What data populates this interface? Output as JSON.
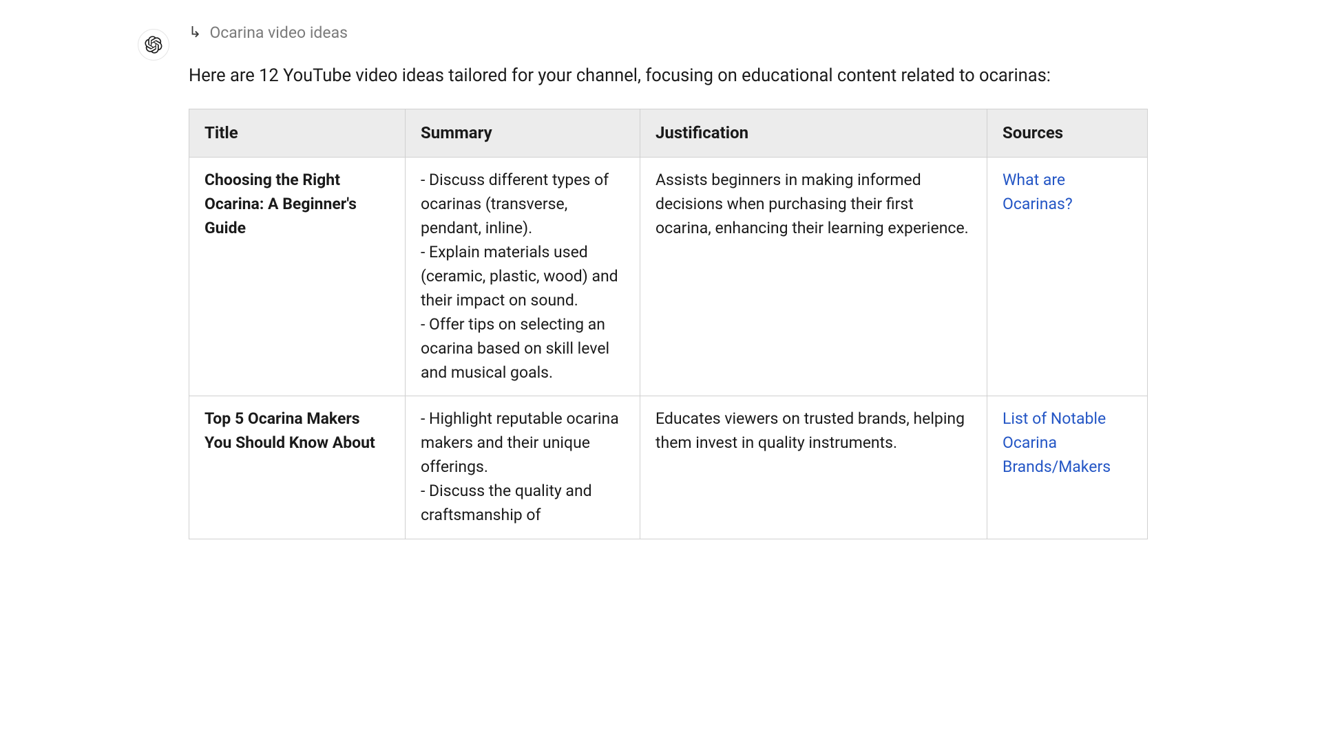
{
  "header": {
    "subtitle": "Ocarina video ideas"
  },
  "intro": "Here are 12 YouTube video ideas tailored for your channel, focusing on educational content related to ocarinas:",
  "table": {
    "headers": {
      "title": "Title",
      "summary": "Summary",
      "justification": "Justification",
      "sources": "Sources"
    },
    "rows": [
      {
        "title": "Choosing the Right Ocarina: A Beginner's Guide",
        "summary": "- Discuss different types of ocarinas (transverse, pendant, inline).\n- Explain materials used (ceramic, plastic, wood) and their impact on sound.\n- Offer tips on selecting an ocarina based on skill level and musical goals.",
        "justification": "Assists beginners in making informed decisions when purchasing their first ocarina, enhancing their learning experience.",
        "source": "What are Ocarinas?"
      },
      {
        "title": "Top 5 Ocarina Makers You Should Know About",
        "summary": "- Highlight reputable ocarina makers and their unique offerings.\n- Discuss the quality and craftsmanship of",
        "justification": "Educates viewers on trusted brands, helping them invest in quality instruments.",
        "source": "List of Notable Ocarina Brands/Makers"
      }
    ]
  }
}
